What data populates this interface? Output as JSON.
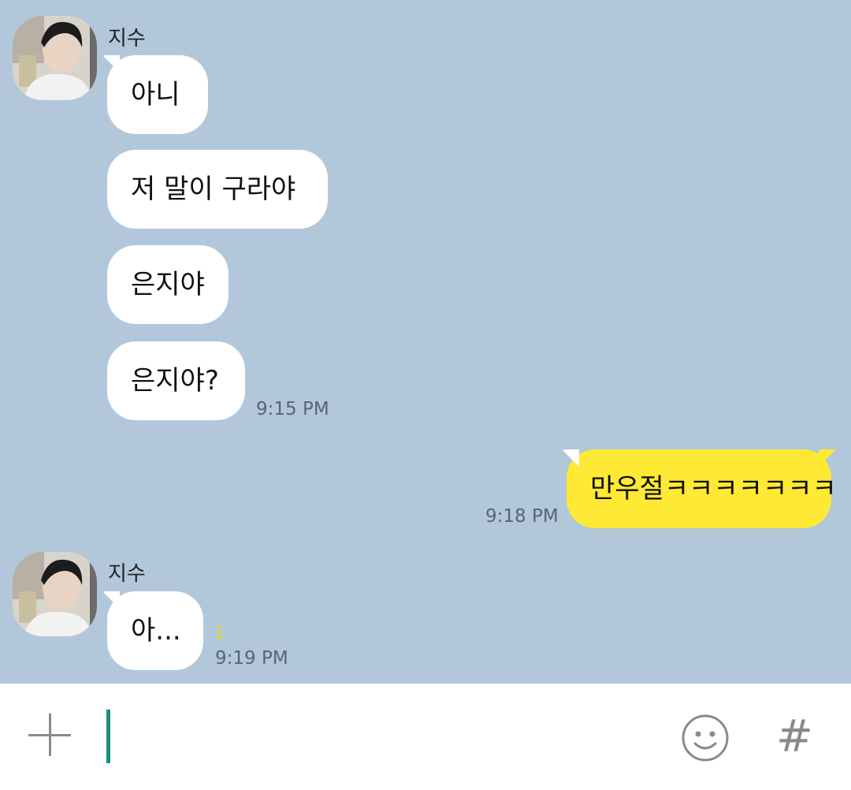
{
  "colors": {
    "chat_background": "#b2c7da",
    "incoming_bubble": "#ffffff",
    "outgoing_bubble": "#fee934",
    "unread_count": "#f2d21b",
    "cursor": "#1e8c7a"
  },
  "groups": [
    {
      "sender": "지수",
      "avatar_icon": "profile-photo-icon",
      "messages": [
        "아니",
        "저 말이 구라야",
        "은지야",
        "은지야?"
      ],
      "time": "9:15 PM"
    },
    {
      "outgoing": true,
      "messages": [
        "만우절ㅋㅋㅋㅋㅋㅋㅋ"
      ],
      "time": "9:18 PM"
    },
    {
      "sender": "지수",
      "avatar_icon": "profile-photo-icon",
      "messages": [
        "아..."
      ],
      "unread": "1",
      "time": "9:19 PM"
    }
  ],
  "input_bar": {
    "placeholder": "",
    "value": "",
    "icons": [
      "plus-icon",
      "emoji-icon",
      "hash-icon"
    ],
    "hash_glyph": "#"
  }
}
